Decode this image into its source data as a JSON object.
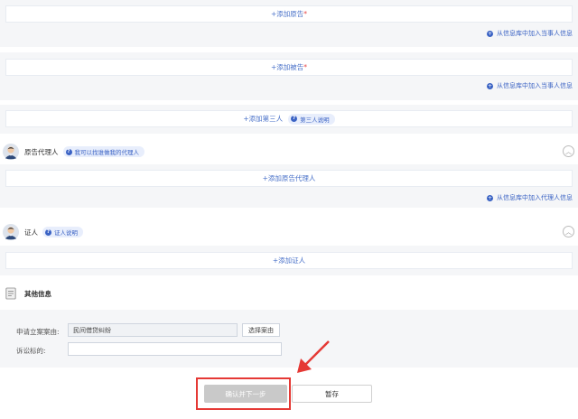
{
  "plaintiff": {
    "add_label": "+添加原告",
    "required_mark": "*",
    "library_link": "从信息库中加入当事人信息"
  },
  "defendant": {
    "add_label": "+添加被告",
    "required_mark": "*",
    "library_link": "从信息库中加入当事人信息"
  },
  "third_party": {
    "add_label": "+添加第三人",
    "help_pill": "第三人说明"
  },
  "plaintiff_agent": {
    "title": "原告代理人",
    "help_pill": "我可以找谁做我的代理人",
    "add_label": "+添加原告代理人",
    "library_link": "从信息库中加入代理人信息",
    "collapse_glyph": "︿"
  },
  "witness": {
    "title": "证人",
    "help_pill": "证人说明",
    "add_label": "+添加证人",
    "collapse_glyph": "︿"
  },
  "other_info": {
    "title": "其他信息",
    "case_reason_label": "申请立案案由:",
    "case_reason_value": "民间借贷纠纷",
    "choose_reason_button": "选择案由",
    "claim_target_label": "诉讼标的:",
    "claim_target_value": ""
  },
  "actions": {
    "confirm_next": "确认并下一步",
    "save_draft": "暂存"
  },
  "colors": {
    "accent_blue": "#3b63c4",
    "annotation_red": "#e53935",
    "required_red": "#e64545"
  },
  "icons": {
    "plus": "plus-circle-icon",
    "question": "question-circle-icon",
    "collapse": "chevron-up-icon",
    "avatar": "user-avatar-icon",
    "document": "document-icon"
  }
}
